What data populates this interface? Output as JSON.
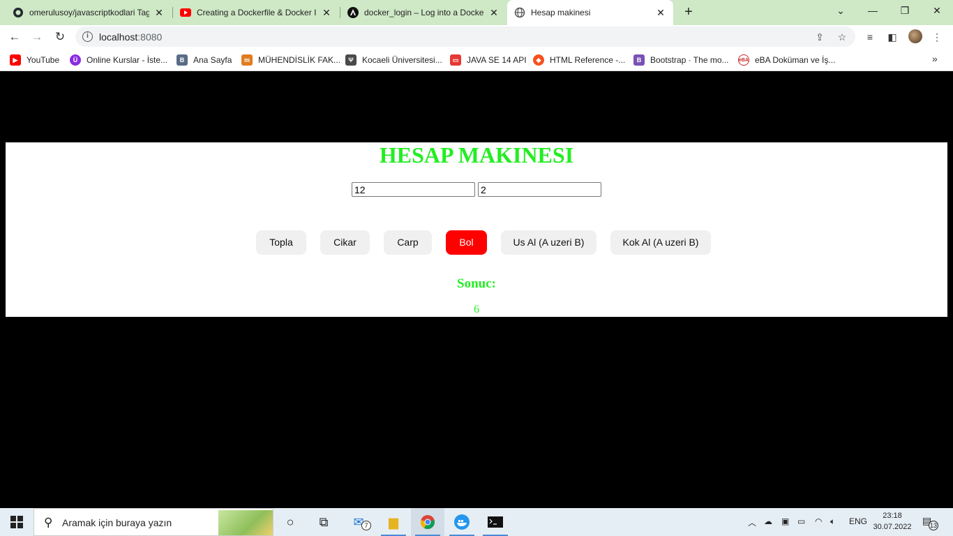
{
  "browser": {
    "tabs": [
      {
        "title": "omerulusoy/javascriptkodlari Tag",
        "icon": "github-icon"
      },
      {
        "title": "Creating a Dockerfile & Docker Im",
        "icon": "youtube-icon"
      },
      {
        "title": "docker_login – Log into a Docker",
        "icon": "ansible-icon"
      },
      {
        "title": "Hesap makinesi",
        "icon": "globe-icon"
      }
    ],
    "new_tab": "+",
    "url_host": "localhost",
    "url_port": ":8080",
    "bookmarks": [
      {
        "label": "YouTube",
        "color": "#ff0000"
      },
      {
        "label": "Online Kurslar - İste...",
        "color": "#8a2be2"
      },
      {
        "label": "Ana Sayfa",
        "color": "#5a6b86"
      },
      {
        "label": "MÜHENDİSLİK FAK...",
        "color": "#e07b1f"
      },
      {
        "label": "Kocaeli Üniversitesi...",
        "color": "#4a4a4a"
      },
      {
        "label": "JAVA SE 14 API",
        "color": "#e53935"
      },
      {
        "label": "HTML Reference -...",
        "color": "#f4511e"
      },
      {
        "label": "Bootstrap · The mo...",
        "color": "#7952b3"
      },
      {
        "label": "eBA Doküman ve İş...",
        "color": "#c62828"
      }
    ]
  },
  "calculator": {
    "title": "HESAP MAKINESI",
    "input_a": "12",
    "input_b": "2",
    "buttons": [
      "Topla",
      "Cikar",
      "Carp",
      "Bol",
      "Us Al (A uzeri B)",
      "Kok Al (A uzeri B)"
    ],
    "active_button": "Bol",
    "result_label": "Sonuc:",
    "result_value": "6",
    "colors": {
      "heading": "#22ee22",
      "active": "#ff0000"
    }
  },
  "taskbar": {
    "search_placeholder": "Aramak için buraya yazın",
    "mail_badge": "7",
    "language": "ENG",
    "time": "23:18",
    "date": "30.07.2022",
    "notification_count": "13"
  }
}
